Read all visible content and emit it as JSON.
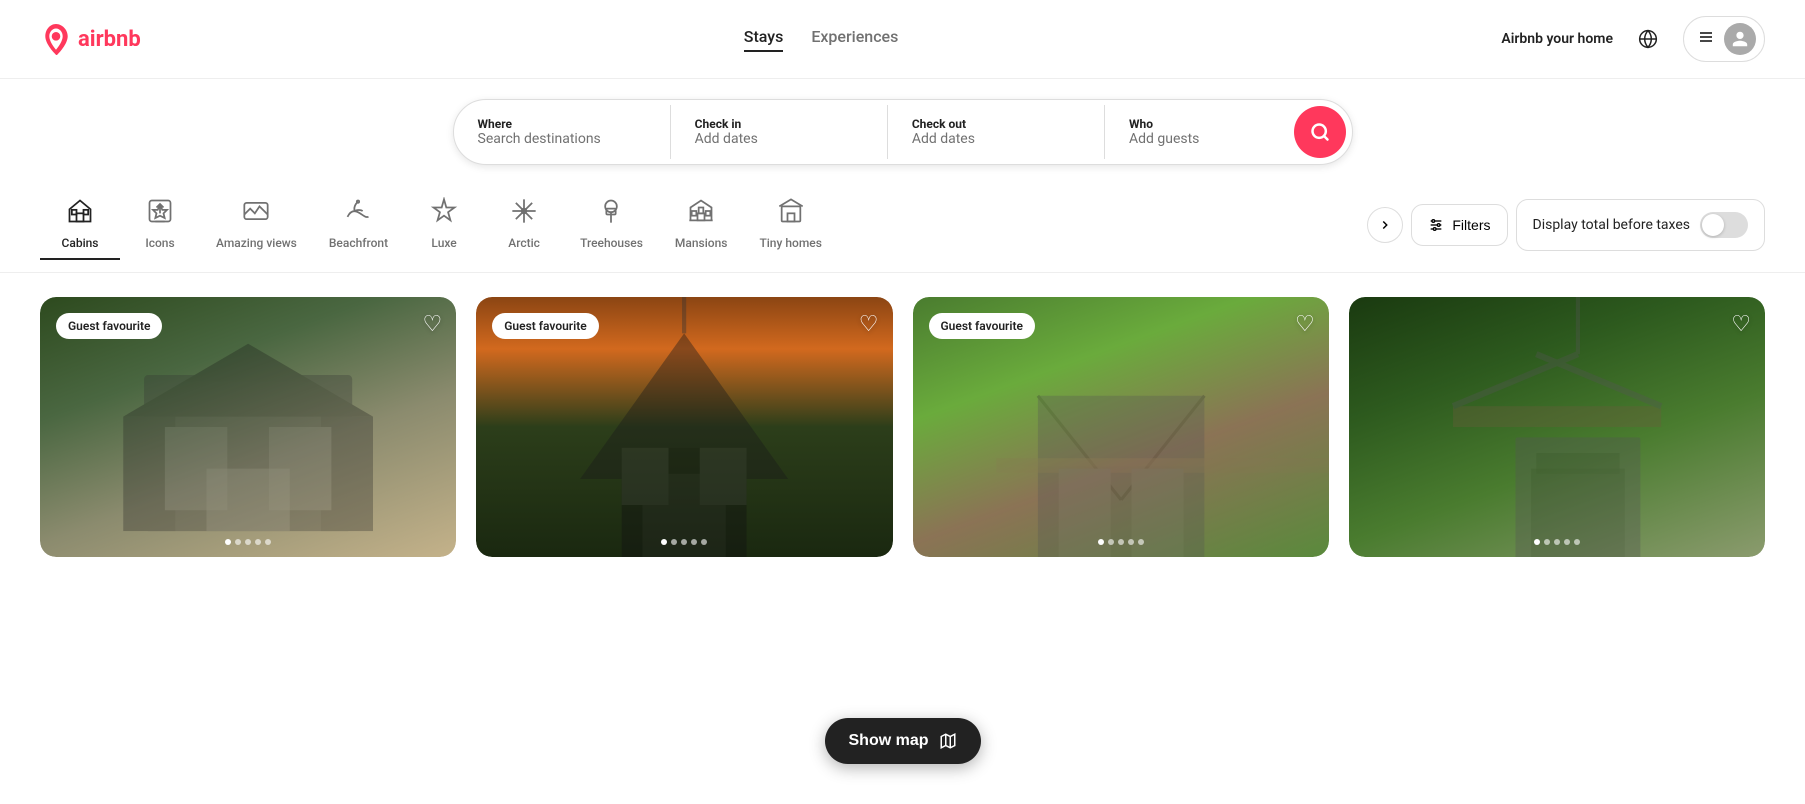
{
  "header": {
    "logo_text": "airbnb",
    "nav": {
      "stays_label": "Stays",
      "experiences_label": "Experiences"
    },
    "airbnb_home_label": "Airbnb your home",
    "menu_aria": "Menu"
  },
  "search_bar": {
    "where_label": "Where",
    "where_placeholder": "Search destinations",
    "checkin_label": "Check in",
    "checkin_value": "Add dates",
    "checkout_label": "Check out",
    "checkout_value": "Add dates",
    "who_label": "Who",
    "who_placeholder": "Add guests"
  },
  "categories": [
    {
      "id": "cabins",
      "label": "Cabins",
      "active": true
    },
    {
      "id": "icons",
      "label": "Icons",
      "active": false
    },
    {
      "id": "amazing_views",
      "label": "Amazing views",
      "active": false
    },
    {
      "id": "beachfront",
      "label": "Beachfront",
      "active": false
    },
    {
      "id": "luxe",
      "label": "Luxe",
      "active": false
    },
    {
      "id": "arctic",
      "label": "Arctic",
      "active": false
    },
    {
      "id": "treehouses",
      "label": "Treehouses",
      "active": false
    },
    {
      "id": "mansions",
      "label": "Mansions",
      "active": false
    },
    {
      "id": "tiny_homes",
      "label": "Tiny homes",
      "active": false
    }
  ],
  "filters": {
    "label": "Filters",
    "taxes_label": "Display total before taxes"
  },
  "listings": [
    {
      "id": 1,
      "guest_favourite": true,
      "img_class": "img-cabin1",
      "dots": [
        true,
        false,
        false,
        false,
        false
      ]
    },
    {
      "id": 2,
      "guest_favourite": true,
      "img_class": "img-cabin2",
      "dots": [
        true,
        false,
        false,
        false,
        false
      ]
    },
    {
      "id": 3,
      "guest_favourite": true,
      "img_class": "img-cabin3",
      "dots": [
        true,
        false,
        false,
        false,
        false
      ]
    },
    {
      "id": 4,
      "guest_favourite": false,
      "img_class": "img-cabin4",
      "dots": [
        true,
        false,
        false,
        false,
        false
      ]
    }
  ],
  "show_map": {
    "label": "Show map"
  },
  "guest_favourite_label": "Guest favourite"
}
